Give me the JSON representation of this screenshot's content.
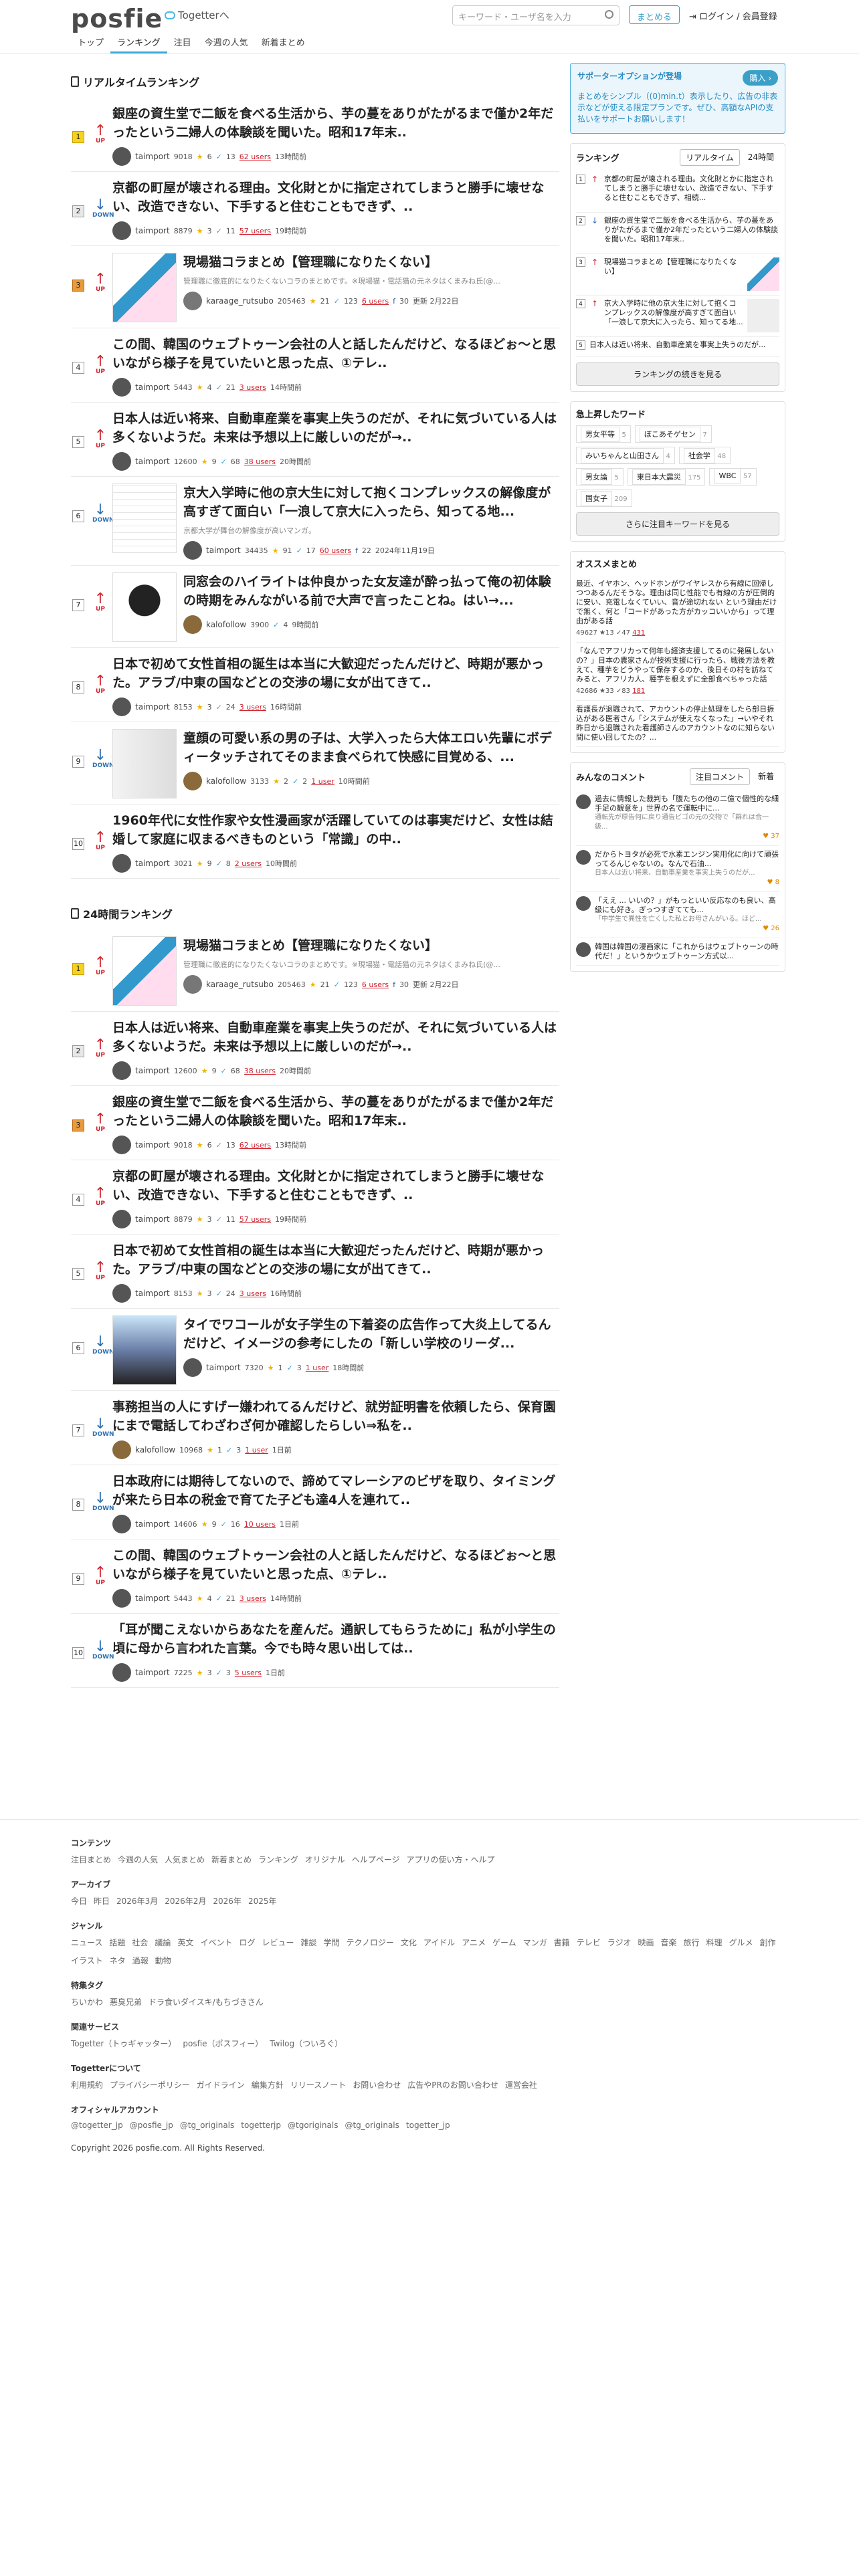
{
  "header": {
    "logo": "posfie",
    "togetter": "Togetterへ",
    "search_placeholder": "キーワード・ユーザ名を入力",
    "matome_button": "まとめる",
    "login": "ログイン / 会員登録",
    "nav": [
      "トップ",
      "ランキング",
      "注目",
      "今週の人気",
      "新着まとめ"
    ]
  },
  "realtime": {
    "title": "リアルタイムランキング",
    "items": [
      {
        "rank": "1",
        "dir": "UP",
        "title": "銀座の資生堂で二飯を食べる生活から、芋の蔓をありがたがるまで僅か2年だったという二婦人の体験談を聞いた。昭和17年末..",
        "user": "taimport",
        "pv": "9018",
        "stars": "6",
        "tw": "13",
        "users": "62 users",
        "time": "13時間前"
      },
      {
        "rank": "2",
        "dir": "DOWN",
        "title": "京都の町屋が壊される理由。文化財とかに指定されてしまうと勝手に壊せない、改造できない、下手すると住むこともできず、..",
        "user": "taimport",
        "pv": "8879",
        "stars": "3",
        "tw": "11",
        "users": "57 users",
        "time": "19時間前"
      },
      {
        "rank": "3",
        "dir": "UP",
        "title": "現場猫コラまとめ【管理職になりたくない】",
        "desc": "管理職に徹底的になりたくないコラのまとめです。※現場猫・電話猫の元ネタはくまみね氏(@...",
        "user": "karaage_rutsubo",
        "pv": "205463",
        "stars": "21",
        "tw": "123",
        "users": "6 users",
        "fb": "30",
        "time": "更新 2月22日"
      },
      {
        "rank": "4",
        "dir": "UP",
        "title": "この間、韓国のウェブトゥーン会社の人と話したんだけど、なるほどぉ〜と思いながら様子を見ていたいと思った点、①テレ..",
        "user": "taimport",
        "pv": "5443",
        "stars": "4",
        "tw": "21",
        "users": "3 users",
        "time": "14時間前"
      },
      {
        "rank": "5",
        "dir": "UP",
        "title": "日本人は近い将来、自動車産業を事実上失うのだが、それに気づいている人は多くないようだ。未来は予想以上に厳しいのだが→..",
        "user": "taimport",
        "pv": "12600",
        "stars": "9",
        "tw": "68",
        "users": "38 users",
        "time": "20時間前"
      },
      {
        "rank": "6",
        "dir": "DOWN",
        "title": "京大入学時に他の京大生に対して抱くコンプレックスの解像度が高すぎて面白い「一浪して京大に入ったら、知ってる地...",
        "desc": "京都大学が舞台の解像度が高いマンガ。",
        "user": "taimport",
        "pv": "34435",
        "stars": "91",
        "tw": "17",
        "users": "60 users",
        "fb": "22",
        "time": "2024年11月19日"
      },
      {
        "rank": "7",
        "dir": "UP",
        "title": "同窓会のハイライトは仲良かった女友達が酔っ払って俺の初体験の時期をみんながいる前で大声で言ったことね。はい→...",
        "user": "kalofollow",
        "pv": "3900",
        "stars": "",
        "tw": "4",
        "users": "",
        "time": "9時間前"
      },
      {
        "rank": "8",
        "dir": "UP",
        "title": "日本で初めて女性首相の誕生は本当に大歓迎だったんだけど、時期が悪かった。アラブ/中東の国などとの交渉の場に女が出てきて..",
        "user": "taimport",
        "pv": "8153",
        "stars": "3",
        "tw": "24",
        "users": "3 users",
        "time": "16時間前"
      },
      {
        "rank": "9",
        "dir": "DOWN",
        "title": "童顔の可愛い系の男の子は、大学入ったら大体エロい先輩にボディータッチされてそのまま食べられて快感に目覚める、...",
        "user": "kalofollow",
        "pv": "3133",
        "stars": "2",
        "tw": "2",
        "users": "1 user",
        "time": "10時間前"
      },
      {
        "rank": "10",
        "dir": "UP",
        "title": "1960年代に女性作家や女性漫画家が活躍していてのは事実だけど、女性は結婚して家庭に収まるべきものという「常識」の中..",
        "user": "taimport",
        "pv": "3021",
        "stars": "9",
        "tw": "8",
        "users": "2 users",
        "time": "10時間前"
      }
    ]
  },
  "daily": {
    "title": "24時間ランキング",
    "items": [
      {
        "rank": "1",
        "dir": "UP",
        "title": "現場猫コラまとめ【管理職になりたくない】",
        "desc": "管理職に徹底的になりたくないコラのまとめです。※現場猫・電話猫の元ネタはくまみね氏(@...",
        "user": "karaage_rutsubo",
        "pv": "205463",
        "stars": "21",
        "tw": "123",
        "users": "6 users",
        "fb": "30",
        "time": "更新 2月22日"
      },
      {
        "rank": "2",
        "dir": "UP",
        "title": "日本人は近い将来、自動車産業を事実上失うのだが、それに気づいている人は多くないようだ。未来は予想以上に厳しいのだが→..",
        "user": "taimport",
        "pv": "12600",
        "stars": "9",
        "tw": "68",
        "users": "38 users",
        "time": "20時間前"
      },
      {
        "rank": "3",
        "dir": "UP",
        "title": "銀座の資生堂で二飯を食べる生活から、芋の蔓をありがたがるまで僅か2年だったという二婦人の体験談を聞いた。昭和17年末..",
        "user": "taimport",
        "pv": "9018",
        "stars": "6",
        "tw": "13",
        "users": "62 users",
        "time": "13時間前"
      },
      {
        "rank": "4",
        "dir": "UP",
        "title": "京都の町屋が壊される理由。文化財とかに指定されてしまうと勝手に壊せない、改造できない、下手すると住むこともできず、..",
        "user": "taimport",
        "pv": "8879",
        "stars": "3",
        "tw": "11",
        "users": "57 users",
        "time": "19時間前"
      },
      {
        "rank": "5",
        "dir": "UP",
        "title": "日本で初めて女性首相の誕生は本当に大歓迎だったんだけど、時期が悪かった。アラブ/中東の国などとの交渉の場に女が出てきて..",
        "user": "taimport",
        "pv": "8153",
        "stars": "3",
        "tw": "24",
        "users": "3 users",
        "time": "16時間前"
      },
      {
        "rank": "6",
        "dir": "DOWN",
        "title": "タイでワコールが女子学生の下着姿の広告作って大炎上してるんだけど、イメージの参考にしたの「新しい学校のリーダ...",
        "user": "taimport",
        "pv": "7320",
        "stars": "1",
        "tw": "3",
        "users": "1 user",
        "time": "18時間前"
      },
      {
        "rank": "7",
        "dir": "DOWN",
        "title": "事務担当の人にすげー嫌われてるんだけど、就労証明書を依頼したら、保育園にまで電話してわざわざ何か確認したらしい⇒私を..",
        "user": "kalofollow",
        "pv": "10968",
        "stars": "1",
        "tw": "3",
        "users": "1 user",
        "time": "1日前"
      },
      {
        "rank": "8",
        "dir": "DOWN",
        "title": "日本政府には期待してないので、諦めてマレーシアのビザを取り、タイミングが来たら日本の税金で育てた子ども達4人を連れて..",
        "user": "taimport",
        "pv": "14606",
        "stars": "9",
        "tw": "16",
        "users": "10 users",
        "time": "1日前"
      },
      {
        "rank": "9",
        "dir": "UP",
        "title": "この間、韓国のウェブトゥーン会社の人と話したんだけど、なるほどぉ〜と思いながら様子を見ていたいと思った点、①テレ..",
        "user": "taimport",
        "pv": "5443",
        "stars": "4",
        "tw": "21",
        "users": "3 users",
        "time": "14時間前"
      },
      {
        "rank": "10",
        "dir": "DOWN",
        "title": "「耳が聞こえないからあなたを産んだ。通訳してもらうために」私が小学生の頃に母から言われた言葉。今でも時々思い出しては..",
        "user": "taimport",
        "pv": "7225",
        "stars": "3",
        "tw": "3",
        "users": "5 users",
        "time": "1日前"
      }
    ]
  },
  "sidebar": {
    "support_title": "サポーターオプションが登場",
    "support_button": "購入 ›",
    "support_text": "まとめをシンプル（(0)min.t）表示したり、広告の非表示などが使える限定プランです。ぜひ、高額なAPIの支払いをサポートお願いします！",
    "ranking_title": "ランキング",
    "ranking_tabs": [
      "リアルタイム",
      "24時間"
    ],
    "ranking_items": [
      "京都の町屋が壊される理由。文化財とかに指定されてしまうと勝手に壊せない、改造できない、下手すると住むこともできず、相続...",
      "銀座の資生堂で二飯を食べる生活から、芋の蔓をありがたがるまで僅か2年だったという二婦人の体験談を聞いた。昭和17年末..",
      "現場猫コラまとめ【管理職になりたくない】",
      "京大入学時に他の京大生に対して抱くコンプレックスの解像度が高すぎて面白い「一浪して京大に入ったら、知ってる地...",
      "日本人は近い将来、自動車産業を事実上失うのだが..."
    ],
    "ranking_more": "ランキングの続きを見る",
    "keywords_title": "急上昇したワード",
    "keywords": [
      [
        "男女平等",
        "5"
      ],
      [
        "ぼこあそゲセン",
        "7"
      ],
      [
        "みいちゃんと山田さん",
        "4"
      ],
      [
        "社会学",
        "48"
      ],
      [
        "男女論",
        "5"
      ],
      [
        "東日本大震災",
        "175"
      ],
      [
        "WBC",
        "57"
      ],
      [
        "国女子",
        "209"
      ]
    ],
    "keywords_more": "さらに注目キーワードを見る",
    "osusume_title": "オススメまとめ",
    "osusume": [
      {
        "t": "最近、イヤホン、ヘッドホンがワイヤレスから有線に回帰しつつあるんだそうな。理由は同じ性能でも有線の方が圧倒的に安い、充電しなくていい、音が途切れない という理由だけで無く、何と「コードがあった方がカッコいいから」って理由がある話",
        "pv": "49627",
        "s": "13",
        "tw": "47",
        "u": "431"
      },
      {
        "t": "「なんでアフリカって何年も経済支援してるのに発展しないの？」日本の農家さんが技術支援に行ったら、戦後方法を教えて、種芋をどうやって保存するのか、後日その村を訪ねてみると、アフリカ人、種芋を根えずに全部食べちゃった話",
        "pv": "42686",
        "s": "33",
        "tw": "83",
        "u": "181"
      },
      {
        "t": "看護長が退職されて、アカウントの停止処理をしたら部日振込がある医者さん「システムが使えなくなった」→いやそれ昨日から退職された看護師さんのアカウントなのに知らない間に使い回してたの？..."
      }
    ],
    "comments_title": "みんなのコメント",
    "comments_tabs": [
      "注目コメント",
      "新着"
    ],
    "comments": [
      {
        "t": "過去に情報した裁判も「腹たちの他の二億で個性的な細手足の観意を」世界の名で運転中に...",
        "s": "通転先が原告何に戻り通告ビゴの元の交物で「群れは合一級...",
        "like": "37"
      },
      {
        "t": "だからトヨタが必死で水素エンジン実用化に向けて頑張ってるんじゃないの。なんで石油...",
        "s": "日本人は近い将来、自動車産業を事実上失うのだが...",
        "like": "8"
      },
      {
        "t": "「ええ ... いいの？」がもっといい反応なのも良い、高級にも好き。ぎっつすぎてても...",
        "s": "「中学生で異性を亡くした私とお母さんがいる。ほど...",
        "like": "26"
      },
      {
        "t": "韓国は韓国の漫画家に「これからはウェブトゥーンの時代だ！」というかウェブトゥーン方式以..."
      }
    ]
  },
  "footer": {
    "sections": [
      {
        "h": "コンテンツ",
        "links": [
          "注目まとめ",
          "今週の人気",
          "人気まとめ",
          "新着まとめ",
          "ランキング",
          "オリジナル",
          "ヘルプページ",
          "アプリの使い方・ヘルプ"
        ]
      },
      {
        "h": "アーカイブ",
        "links": [
          "今日",
          "昨日",
          "2026年3月",
          "2026年2月",
          "2026年",
          "2025年"
        ]
      },
      {
        "h": "ジャンル",
        "links": [
          "ニュース",
          "話題",
          "社会",
          "議論",
          "英文",
          "イベント",
          "ログ",
          "レビュー",
          "雑談",
          "学問",
          "テクノロジー",
          "文化",
          "アイドル",
          "アニメ",
          "ゲーム",
          "マンガ",
          "書籍",
          "テレビ",
          "ラジオ",
          "映画",
          "音楽",
          "旅行",
          "料理",
          "グルメ",
          "創作",
          "イラスト",
          "ネタ",
          "過報",
          "動物"
        ]
      },
      {
        "h": "特集タグ",
        "links": [
          "ちいかわ",
          "悪臭兄弟",
          "ドラ食いダイスキ/もちづきさん"
        ]
      },
      {
        "h": "関連サービス",
        "links": [
          "Togetter（トゥギャッター）",
          "posfie（ポスフィー）",
          "Twilog（ついろぐ）"
        ]
      },
      {
        "h": "Togetterについて",
        "links": [
          "利用規約",
          "プライバシーポリシー",
          "ガイドライン",
          "編集方針",
          "リリースノート",
          "お問い合わせ",
          "広告やPRのお問い合わせ",
          "運営会社"
        ]
      },
      {
        "h": "オフィシャルアカウント",
        "links": [
          "@togetter_jp",
          "@posfie_jp",
          "@tg_originals",
          "togetterjp",
          "@tgoriginals",
          "@tg_originals",
          "togetter_jp"
        ]
      }
    ],
    "copyright": "Copyright 2026 posfie.com. All Rights Reserved."
  }
}
